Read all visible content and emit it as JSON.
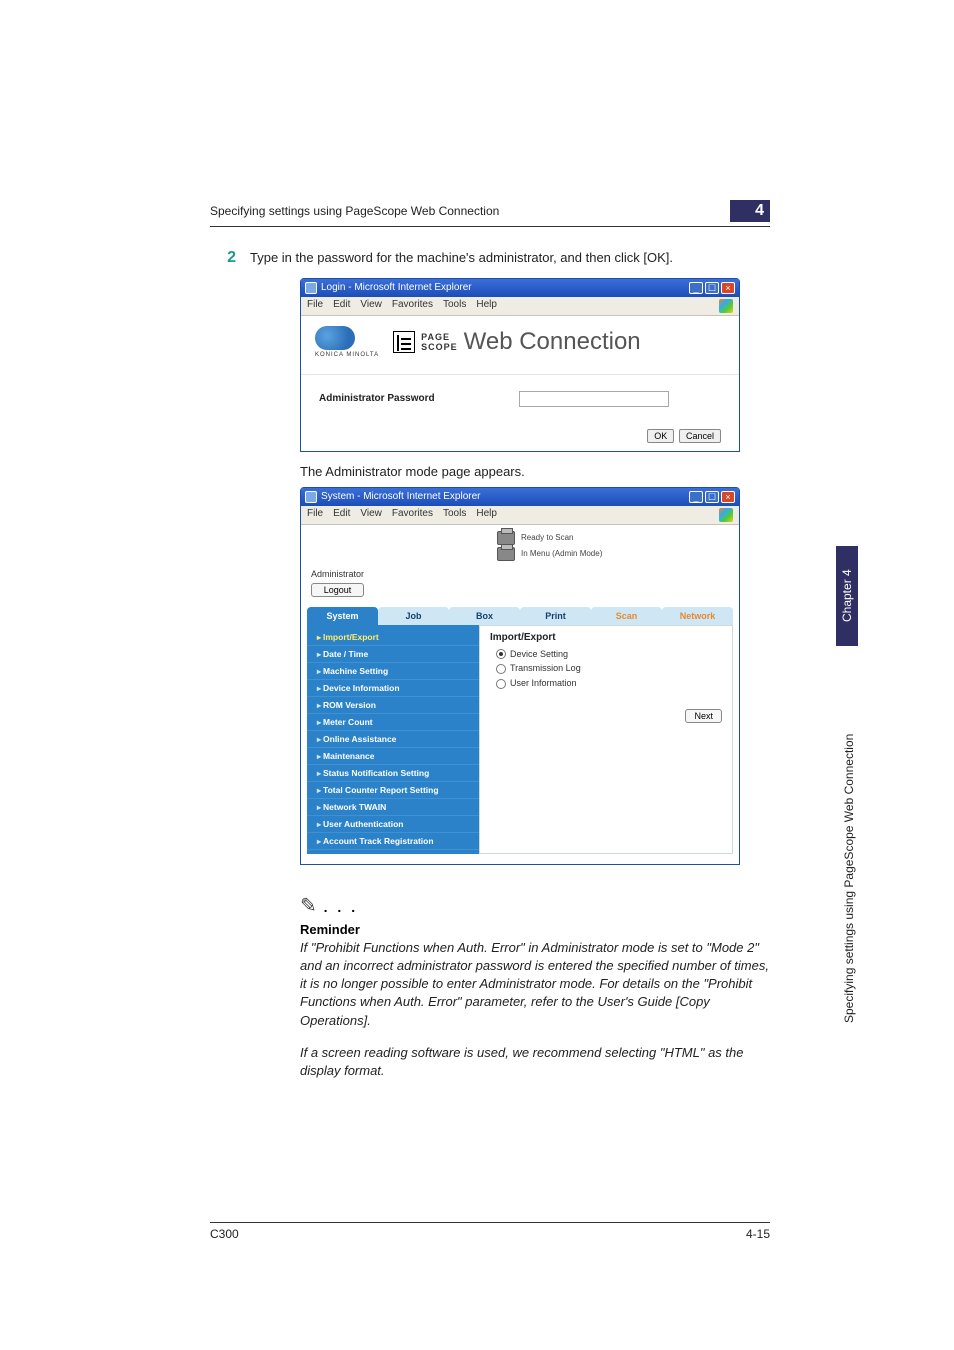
{
  "header": {
    "running_title": "Specifying settings using PageScope Web Connection",
    "chapter_number": "4"
  },
  "step": {
    "number": "2",
    "text": "Type in the password for the machine's administrator, and then click [OK]."
  },
  "login_window": {
    "title": "Login - Microsoft Internet Explorer",
    "menus": [
      "File",
      "Edit",
      "View",
      "Favorites",
      "Tools",
      "Help"
    ],
    "brand_sub": "KONICA MINOLTA",
    "ps_label_top": "PAGE",
    "ps_label_bottom": "SCOPE",
    "ps_main": "Web Connection",
    "password_label": "Administrator Password",
    "ok": "OK",
    "cancel": "Cancel"
  },
  "mid_caption": "The Administrator mode page appears.",
  "admin_window": {
    "title": "System - Microsoft Internet Explorer",
    "menus": [
      "File",
      "Edit",
      "View",
      "Favorites",
      "Tools",
      "Help"
    ],
    "status1": "Ready to Scan",
    "status2": "In Menu (Admin Mode)",
    "role": "Administrator",
    "logout": "Logout",
    "tabs": [
      "System",
      "Job",
      "Box",
      "Print",
      "Scan",
      "Network"
    ],
    "active_tab_index": 0,
    "sidebar_items": [
      "Import/Export",
      "Date / Time",
      "Machine Setting",
      "Device Information",
      "ROM Version",
      "Meter Count",
      "Online Assistance",
      "Maintenance",
      "Status Notification Setting",
      "Total Counter Report Setting",
      "Network TWAIN",
      "User Authentication",
      "Account Track Registration"
    ],
    "active_sidebar_index": 0,
    "panel_title": "Import/Export",
    "radios": [
      {
        "label": "Device Setting",
        "selected": true
      },
      {
        "label": "Transmission Log",
        "selected": false
      },
      {
        "label": "User Information",
        "selected": false
      }
    ],
    "next": "Next"
  },
  "reminder": {
    "heading": "Reminder",
    "body1": "If \"Prohibit Functions when Auth. Error\" in Administrator mode is set to \"Mode 2\" and an incorrect administrator password is entered the specified number of times, it is no longer possible to enter Administrator mode. For details on the \"Prohibit Functions when Auth. Error\" parameter, refer to the User's Guide [Copy Operations].",
    "body2": "If a screen reading software is used, we recommend selecting \"HTML\" as the display format."
  },
  "footer": {
    "model": "C300",
    "page": "4-15"
  },
  "side": {
    "dark": "Chapter 4",
    "light": "Specifying settings using PageScope Web Connection"
  }
}
